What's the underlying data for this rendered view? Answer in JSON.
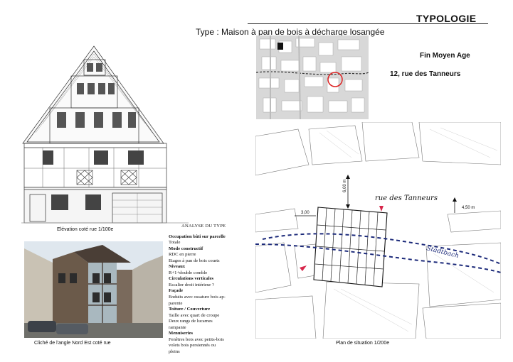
{
  "header": {
    "title": "TYPOLOGIE",
    "type_line": "Type : Maison à pan de bois à décharge losangée",
    "period": "Fin Moyen Age",
    "address": "12, rue des Tanneurs"
  },
  "figures": {
    "elevation_caption": "Elévation coté rue 1/100e",
    "photo_caption": "Cliché de l'angle Nord Est coté rue",
    "plan_caption": "Plan de situation 1/200e"
  },
  "plan": {
    "street": "rue des Tanneurs",
    "river": "Stadtbach",
    "dim_width": "6,00 m",
    "dim_left": "3,00",
    "dim_right": "4,50 m"
  },
  "analysis": {
    "title": "ANALYSE DU TYPE",
    "lines": [
      {
        "text": "Occupation bâti sur parcelle",
        "bold": true
      },
      {
        "text": "Totale",
        "bold": false
      },
      {
        "text": "Mode constructif",
        "bold": true
      },
      {
        "text": "RDC en pierre",
        "bold": false
      },
      {
        "text": "Etages à pan de bois courts",
        "bold": false
      },
      {
        "text": "Niveaux",
        "bold": true
      },
      {
        "text": "R+1+double comble",
        "bold": false
      },
      {
        "text": "Circulations verticales",
        "bold": true
      },
      {
        "text": "Escalier droit intérieur ?",
        "bold": false
      },
      {
        "text": "Façade",
        "bold": true
      },
      {
        "text": "Enduits avec ossature bois ap-",
        "bold": false
      },
      {
        "text": "parente",
        "bold": false
      },
      {
        "text": "Toiture / Couverture",
        "bold": true
      },
      {
        "text": "Taille avec quart de croupe",
        "bold": false
      },
      {
        "text": "Deux rangs de lucarnes",
        "bold": false
      },
      {
        "text": "rampante",
        "bold": false
      },
      {
        "text": "Menuiseries",
        "bold": true
      },
      {
        "text": "Fenêtres bois avec petits-bois",
        "bold": false
      },
      {
        "text": "volets bois persiennés ou",
        "bold": false
      },
      {
        "text": "pleins",
        "bold": false
      }
    ]
  }
}
